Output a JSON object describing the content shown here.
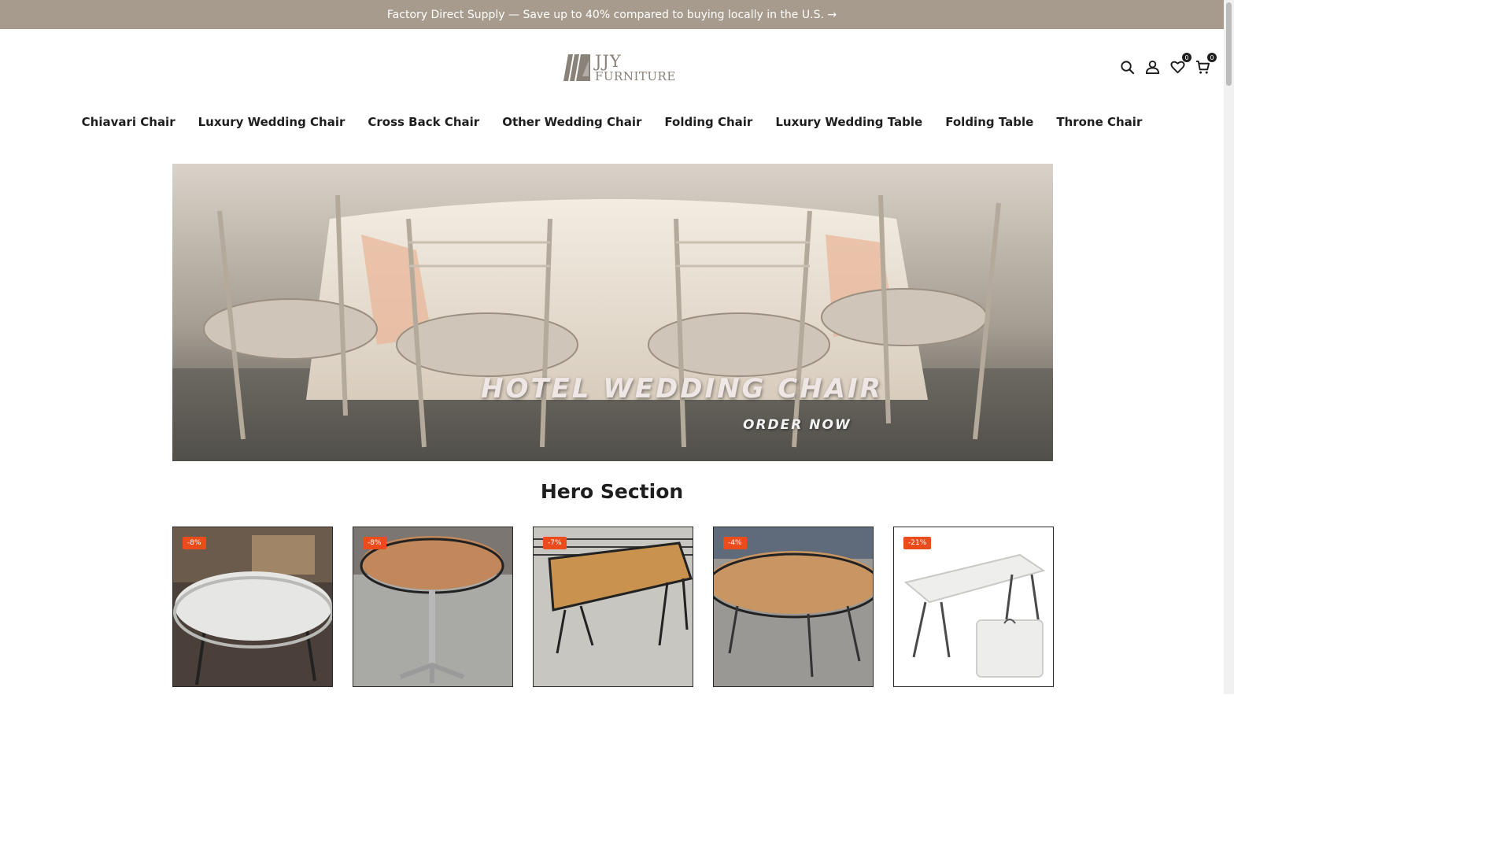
{
  "announcement": {
    "text": "Factory Direct Supply — Save up to 40% compared to buying locally in the U.S. →"
  },
  "logo": {
    "line1": "JJY",
    "line2": "FURNITURE"
  },
  "header_icons": {
    "wishlist_count": "0",
    "cart_count": "0",
    "icons": [
      "search-icon",
      "account-icon",
      "heart-icon",
      "cart-icon"
    ]
  },
  "nav": {
    "items": [
      "Chiavari Chair",
      "Luxury Wedding Chair",
      "Cross Back Chair",
      "Other Wedding Chair",
      "Folding Chair",
      "Luxury Wedding Table",
      "Folding Table",
      "Throne Chair"
    ]
  },
  "hero": {
    "title": "HOTEL WEDDING CHAIR",
    "cta": "ORDER NOW"
  },
  "section": {
    "title": "Hero Section"
  },
  "products": [
    {
      "badge": "-8%"
    },
    {
      "badge": "-8%"
    },
    {
      "badge": "-7%"
    },
    {
      "badge": "-4%"
    },
    {
      "badge": "-21%"
    }
  ],
  "colors": {
    "announcement_bg": "#a69b8c",
    "sale_badge": "#ec4b1c",
    "text": "#1e1e1e"
  }
}
